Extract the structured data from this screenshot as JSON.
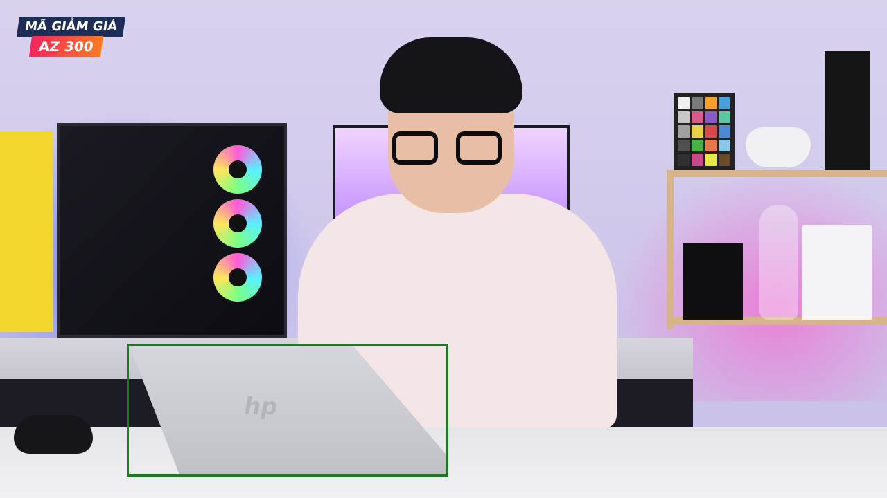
{
  "promo": {
    "line1": "MÃ GIẢM GIÁ",
    "line2": "AZ 300"
  },
  "laptop": {
    "logo_text": "hp"
  },
  "colors": {
    "highlight_border": "#1e7a22",
    "promo_navy": "#1e2e56",
    "promo_red": "#f7255c",
    "promo_orange": "#ff7a22"
  }
}
